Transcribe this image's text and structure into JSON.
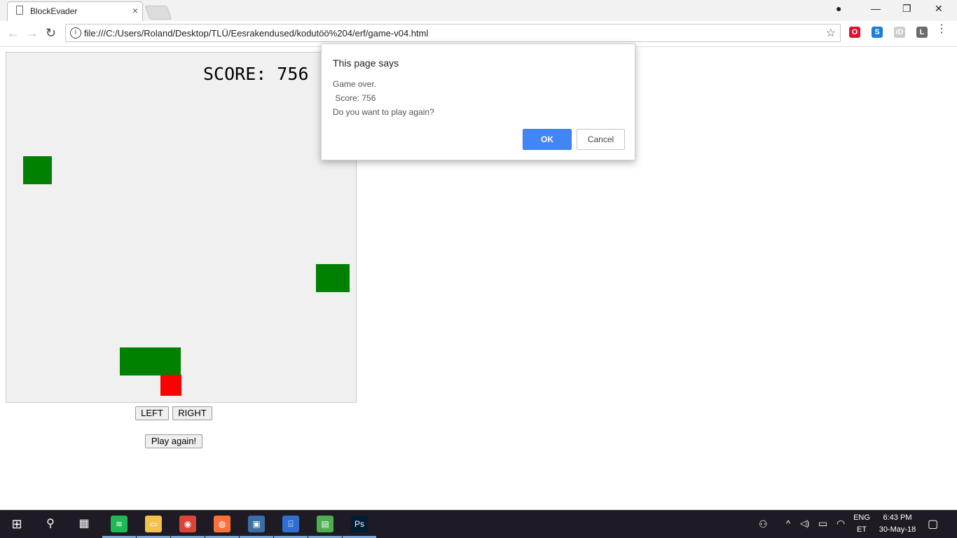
{
  "browser": {
    "tab_title": "BlockEvader",
    "tab_close": "×",
    "url": "file:///C:/Users/Roland/Desktop/TLÜ/Eesrakendused/kodutöö%204/erf/game-v04.html",
    "info_glyph": "i",
    "star_glyph": "☆",
    "back_glyph": "←",
    "forward_glyph": "→",
    "reload_glyph": "↻",
    "minimize_glyph": "—",
    "restore_glyph": "❐",
    "close_glyph": "✕",
    "profile_glyph": "●",
    "extensions": [
      {
        "name": "opera-extension-icon",
        "glyph": "O",
        "color": "#e0112a"
      },
      {
        "name": "s-extension-icon",
        "glyph": "S",
        "color": "#1a7fd6"
      },
      {
        "name": "id-extension-icon",
        "glyph": "iD",
        "color": "#cccccc"
      },
      {
        "name": "l-extension-icon",
        "glyph": "L",
        "color": "#6b6b6b"
      }
    ]
  },
  "game": {
    "score_label": "SCORE: 756",
    "colors": {
      "background": "#f0f0f0",
      "block": "#008000",
      "player": "#ff0000"
    },
    "buttons": {
      "left": "LEFT",
      "right": "RIGHT",
      "play_again": "Play again!"
    }
  },
  "dialog": {
    "title": "This page says",
    "line1": "Game over.",
    "line2": " Score: 756",
    "line3": "Do you want to play again?",
    "ok": "OK",
    "cancel": "Cancel",
    "ok_color": "#4285f4"
  },
  "taskbar": {
    "start_glyph": "⊞",
    "search_glyph": "⚲",
    "taskview_glyph": "▦",
    "apps": [
      {
        "name": "spotify-icon",
        "glyph": "≋",
        "color": "#1db954"
      },
      {
        "name": "file-explorer-icon",
        "glyph": "▭",
        "color": "#f2c14e"
      },
      {
        "name": "chrome-icon",
        "glyph": "◉",
        "color": "#db4437"
      },
      {
        "name": "firefox-icon",
        "glyph": "◍",
        "color": "#ff7139"
      },
      {
        "name": "lock-app-icon",
        "glyph": "▣",
        "color": "#3a6ea5"
      },
      {
        "name": "network-app-icon",
        "glyph": "⌸",
        "color": "#2f6fd0"
      },
      {
        "name": "chart-app-icon",
        "glyph": "▤",
        "color": "#4caf50"
      },
      {
        "name": "photoshop-icon",
        "glyph": "Ps",
        "color": "#001d34"
      }
    ],
    "tray": {
      "people_glyph": "⚇",
      "chevron_glyph": "^",
      "volume_glyph": "◁)",
      "battery_glyph": "▭",
      "wifi_glyph": "◠",
      "lang_top": "ENG",
      "lang_bottom": "ET",
      "time": "6:43 PM",
      "date": "30-May-18",
      "notification_glyph": "▢"
    }
  }
}
